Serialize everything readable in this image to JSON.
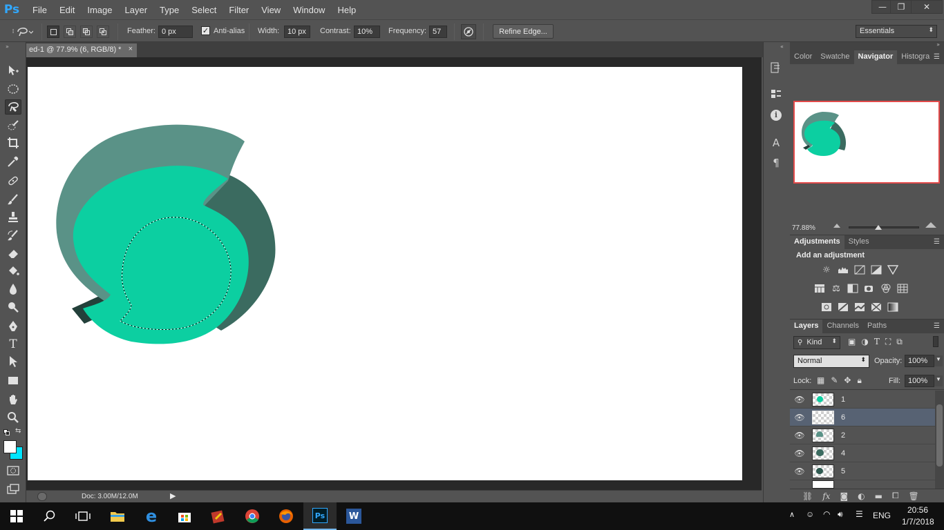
{
  "app": {
    "logo": "Ps"
  },
  "menus": [
    "File",
    "Edit",
    "Image",
    "Layer",
    "Type",
    "Select",
    "Filter",
    "View",
    "Window",
    "Help"
  ],
  "window_controls": {
    "minimize": "—",
    "restore": "❐",
    "close": "✕"
  },
  "options": {
    "feather_label": "Feather:",
    "feather_value": "0 px",
    "antialias_label": "Anti-alias",
    "antialias_checked": true,
    "width_label": "Width:",
    "width_value": "10 px",
    "contrast_label": "Contrast:",
    "contrast_value": "10%",
    "frequency_label": "Frequency:",
    "frequency_value": "57",
    "refine_edge": "Refine Edge...",
    "workspace": "Essentials"
  },
  "document": {
    "tab_title": "ed-1 @ 77.9% (6, RGB/8) *",
    "tab_close": "×",
    "status": "Doc: 3.00M/12.0M"
  },
  "navigator": {
    "tabs": [
      "Color",
      "Swatche",
      "Navigator",
      "Histogra"
    ],
    "active_tab": "Navigator",
    "zoom": "77.88%"
  },
  "adjustments": {
    "tabs": [
      "Adjustments",
      "Styles"
    ],
    "heading": "Add an adjustment"
  },
  "layers": {
    "tabs": [
      "Layers",
      "Channels",
      "Paths"
    ],
    "kind_label": "Kind",
    "blend_mode": "Normal",
    "opacity_label": "Opacity:",
    "opacity_value": "100%",
    "lock_label": "Lock:",
    "fill_label": "Fill:",
    "fill_value": "100%",
    "items": [
      {
        "name": "1",
        "selected": false
      },
      {
        "name": "6",
        "selected": true
      },
      {
        "name": "2",
        "selected": false
      },
      {
        "name": "4",
        "selected": false
      },
      {
        "name": "5",
        "selected": false
      }
    ]
  },
  "colors": {
    "foreground": "#ffffff",
    "background": "#00e5ff",
    "shape_light": "#0ccfa1",
    "shape_grey": "#5a9287",
    "shape_dark": "#3b6b60",
    "shape_darkest": "#23403a",
    "nav_frame": "#e34a4a",
    "selected_layer": "#576273"
  },
  "taskbar": {
    "lang": "ENG",
    "time": "20:56",
    "date": "1/7/2018"
  }
}
